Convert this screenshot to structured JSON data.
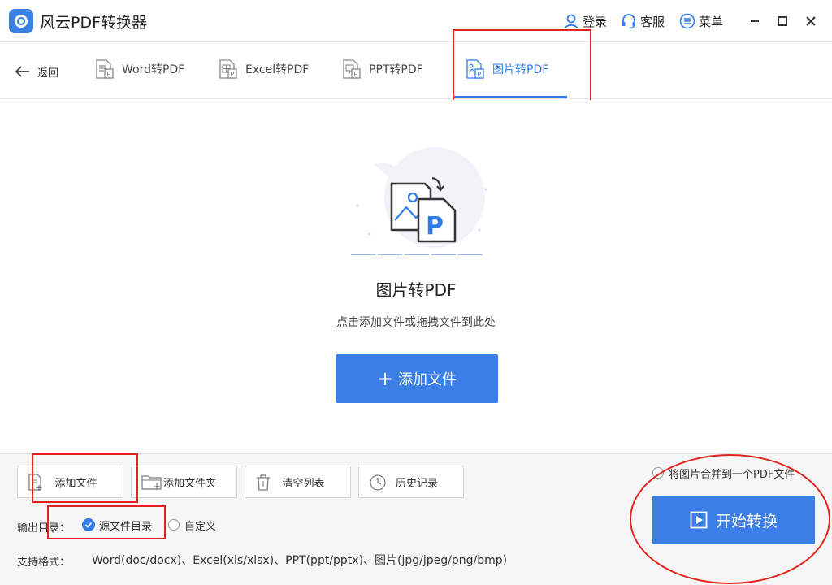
{
  "titlebar": {
    "app_title": "风云PDF转换器",
    "login": "登录",
    "service": "客服",
    "menu": "菜单"
  },
  "nav": {
    "back": "返回",
    "tabs": [
      {
        "label": "Word转PDF",
        "icon": "word-doc-icon"
      },
      {
        "label": "Excel转PDF",
        "icon": "excel-doc-icon"
      },
      {
        "label": "PPT转PDF",
        "icon": "ppt-doc-icon"
      },
      {
        "label": "图片转PDF",
        "icon": "image-doc-icon",
        "active": true
      }
    ]
  },
  "drop": {
    "title": "图片转PDF",
    "hint": "点击添加文件或拖拽文件到此处",
    "add_button": "添加文件"
  },
  "toolbar": {
    "add_file": "添加文件",
    "add_folder": "添加文件夹",
    "clear_list": "清空列表",
    "history": "历史记录"
  },
  "options": {
    "merge_label": "将图片合并到一个PDF文件",
    "output_label": "输出目录：",
    "output_source": "源文件目录",
    "output_custom": "自定义",
    "output_selected": "源文件目录"
  },
  "formats": {
    "label": "支持格式：",
    "value": "Word(doc/docx)、Excel(xls/xlsx)、PPT(ppt/pptx)、图片(jpg/jpeg/png/bmp)"
  },
  "start_button": "开始转换",
  "colors": {
    "accent": "#3a7ee6",
    "annotation_red": "#e0231d"
  }
}
